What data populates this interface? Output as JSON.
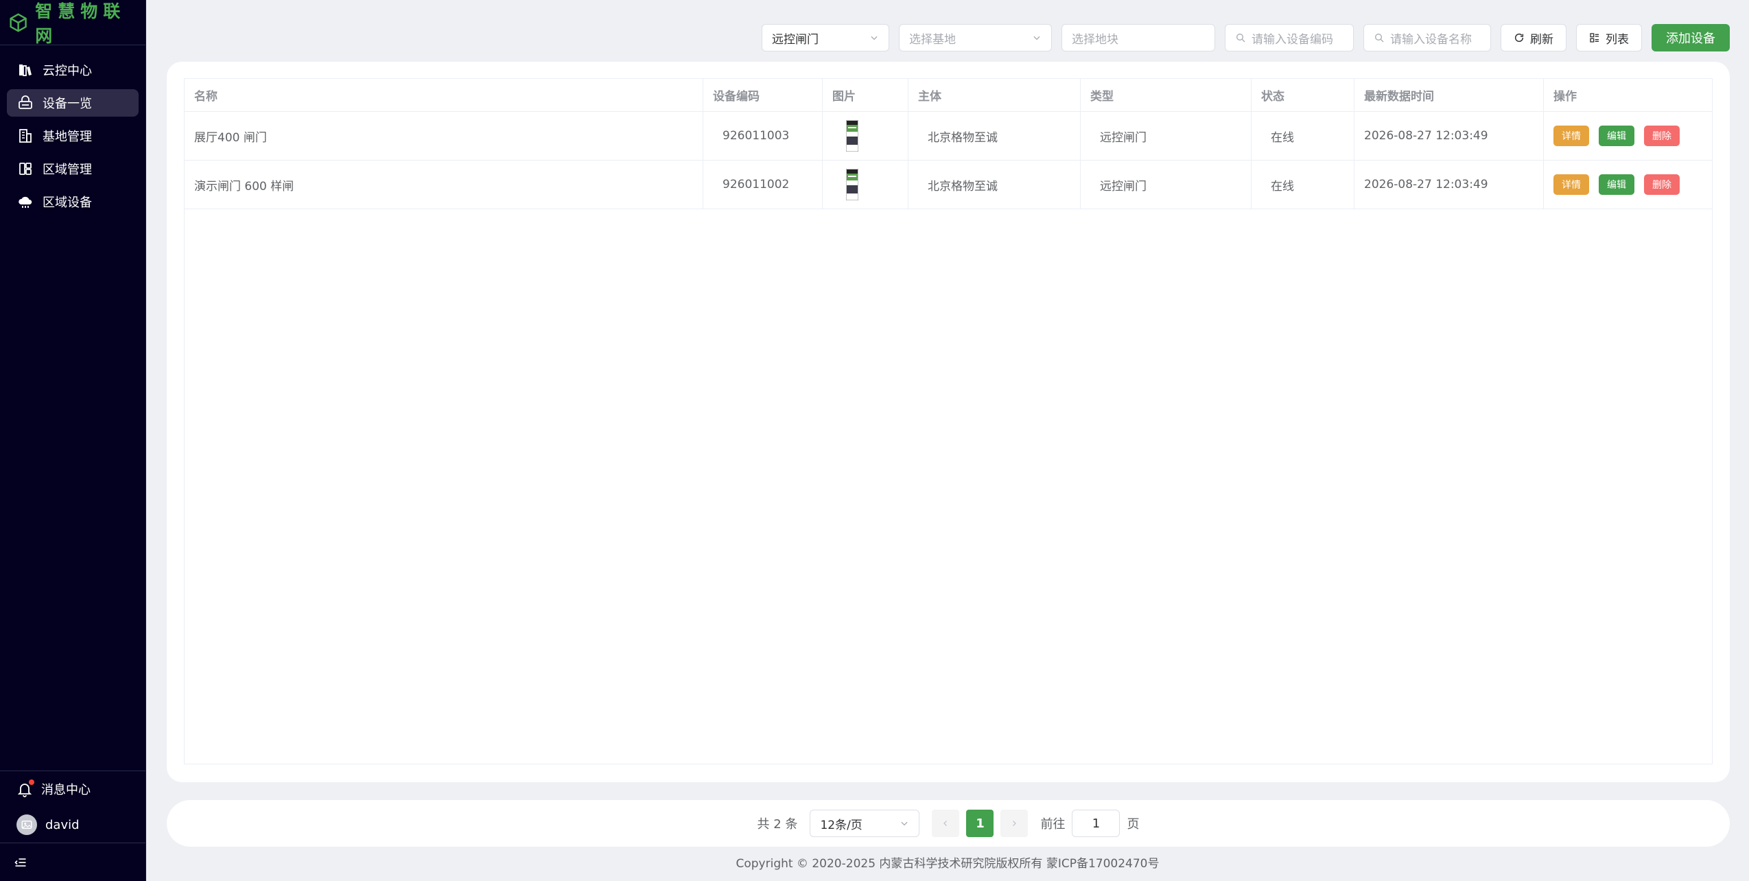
{
  "brand": {
    "title": "智慧物联网",
    "color": "#4caf50"
  },
  "sidebar": {
    "items": [
      {
        "label": "云控中心",
        "icon": "books-icon",
        "active": false
      },
      {
        "label": "设备一览",
        "icon": "device-icon",
        "active": true
      },
      {
        "label": "基地管理",
        "icon": "building-icon",
        "active": false
      },
      {
        "label": "区域管理",
        "icon": "region-icon",
        "active": false
      },
      {
        "label": "区域设备",
        "icon": "cloud-device-icon",
        "active": false
      }
    ],
    "messages_label": "消息中心",
    "user_name": "david"
  },
  "toolbar": {
    "region_select_value": "远控闸门",
    "base_select_placeholder": "选择基地",
    "block_select_placeholder": "选择地块",
    "code_input_placeholder": "请输入设备编码",
    "name_input_placeholder": "请输入设备名称",
    "refresh_label": "刷新",
    "list_label": "列表",
    "add_label": "添加设备"
  },
  "table": {
    "headers": [
      "名称",
      "设备编码",
      "图片",
      "主体",
      "类型",
      "状态",
      "最新数据时间",
      "操作"
    ],
    "rows": [
      {
        "name": "展厅400 闸门",
        "code": "926011003",
        "owner": "北京格物至诚",
        "type": "远控闸门",
        "status": "在线",
        "time": "2026-08-27 12:03:49"
      },
      {
        "name": "演示闸门 600 样闸",
        "code": "926011002",
        "owner": "北京格物至诚",
        "type": "远控闸门",
        "status": "在线",
        "time": "2026-08-27 12:03:49"
      }
    ],
    "actions": {
      "detail": "详情",
      "edit": "编辑",
      "delete": "删除"
    }
  },
  "pagination": {
    "total_text": "共 2 条",
    "page_size": "12条/页",
    "current_page": "1",
    "goto_label": "前往",
    "goto_value": "1",
    "page_suffix": "页"
  },
  "footer": {
    "text": "Copyright © 2020-2025 内蒙古科学技术研究院版权所有 蒙ICP备17002470号"
  },
  "colors": {
    "primary": "#43a04d",
    "warning": "#e6a23c",
    "danger": "#f56c6c",
    "sidebar_bg": "#03011f"
  }
}
